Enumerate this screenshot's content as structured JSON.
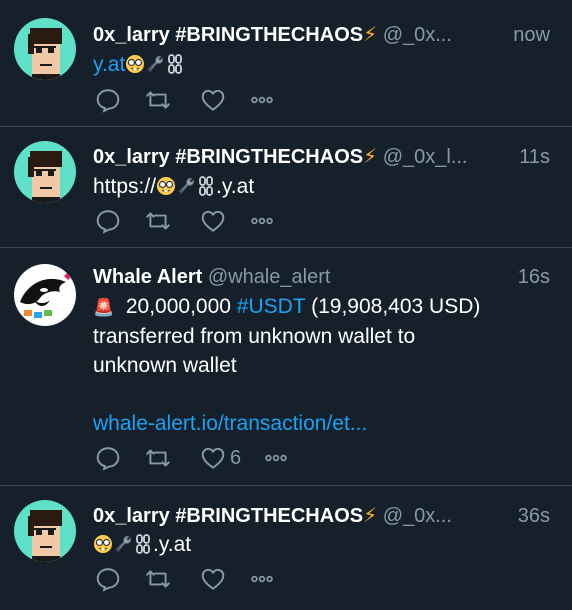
{
  "colors": {
    "background": "#15202b",
    "link": "#1da1f2",
    "muted": "#8899a6",
    "divider": "#38444d",
    "bolt": "#ffad1f"
  },
  "tweets": [
    {
      "author": "0x_larry #BRINGTHECHAOS",
      "bolt": "⚡",
      "handle": "@_0x...",
      "time": "now",
      "text_link": "y.at",
      "text": "",
      "likes": "",
      "avatar": "cryptopunk-avatar"
    },
    {
      "author": "0x_larry #BRINGTHECHAOS",
      "bolt": "⚡",
      "handle": "@_0x_l...",
      "time": "11s",
      "text_prefix": "https://",
      "text_suffix": ".y.at",
      "likes": "",
      "avatar": "cryptopunk-avatar"
    },
    {
      "author": "Whale Alert",
      "handle": "@whale_alert",
      "time": "16s",
      "alert_icon": "🚨",
      "line1_amount": "20,000,000",
      "line1_hashtag": "#USDT",
      "line1_rest": "(19,908,403 USD)",
      "line2": "transferred from unknown wallet to",
      "line3": "unknown wallet",
      "link": "whale-alert.io/transaction/et...",
      "likes": "6",
      "avatar": "whale-orca-avatar"
    },
    {
      "author": "0x_larry #BRINGTHECHAOS",
      "bolt": "⚡",
      "handle": "@_0x...",
      "time": "36s",
      "text_suffix": ".y.at",
      "likes": "",
      "avatar": "cryptopunk-avatar"
    }
  ]
}
